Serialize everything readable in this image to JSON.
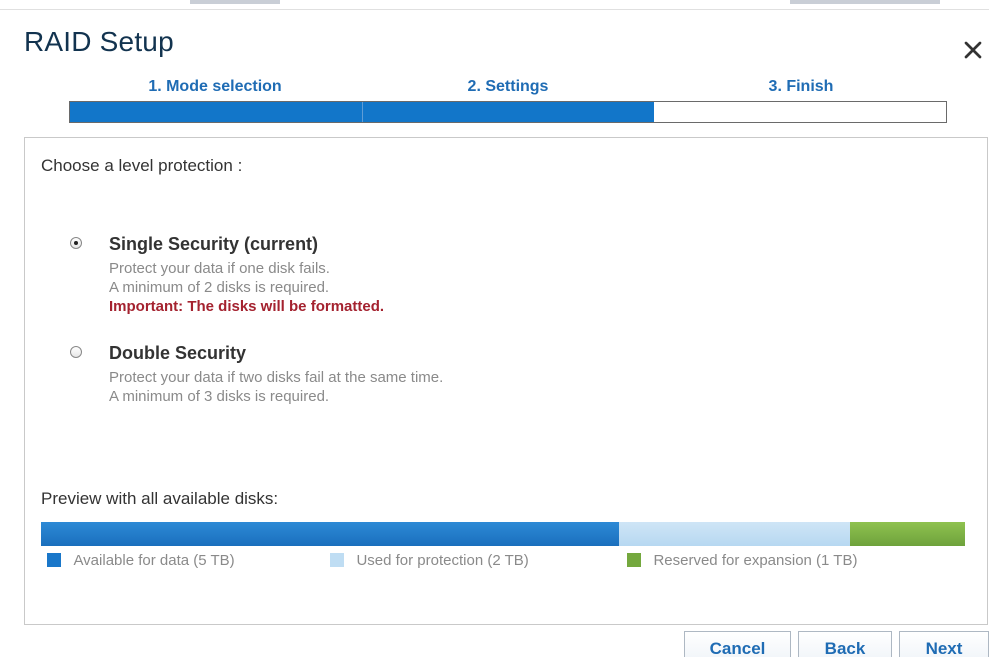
{
  "dialog": {
    "title": "RAID Setup",
    "close_icon": "close-icon"
  },
  "wizard": {
    "steps": [
      {
        "label": "1. Mode selection"
      },
      {
        "label": "2. Settings"
      },
      {
        "label": "3. Finish"
      }
    ],
    "progress_fraction": 0.667
  },
  "content": {
    "title": "Choose a level protection :",
    "options": [
      {
        "id": "single",
        "title": "Single Security (current)",
        "selected": true,
        "description_lines": [
          "Protect your data if one disk fails.",
          "A minimum of 2 disks is required."
        ],
        "important": "Important: The disks will be formatted."
      },
      {
        "id": "double",
        "title": "Double Security",
        "selected": false,
        "description_lines": [
          "Protect your data if two disks fail at the same time.",
          "A minimum of 3 disks is required."
        ]
      }
    ]
  },
  "preview": {
    "title": "Preview with all available disks:",
    "total_tb": 8,
    "segments": [
      {
        "name": "available",
        "value_tb": 5,
        "label": "Available for data (5 TB)",
        "color": "#1A77C9"
      },
      {
        "name": "protection",
        "value_tb": 2,
        "label": "Used for protection (2 TB)",
        "color": "#BFDDF3"
      },
      {
        "name": "reserved",
        "value_tb": 1,
        "label": "Reserved for expansion (1 TB)",
        "color": "#74A83E"
      }
    ]
  },
  "buttons": {
    "cancel_label": "Cancel",
    "back_label": "Back",
    "next_label": "Next"
  },
  "colors": {
    "title": "#12334F",
    "accent": "#1F6CB4",
    "warning": "#A4222F",
    "muted_text": "#8A8A8A"
  }
}
